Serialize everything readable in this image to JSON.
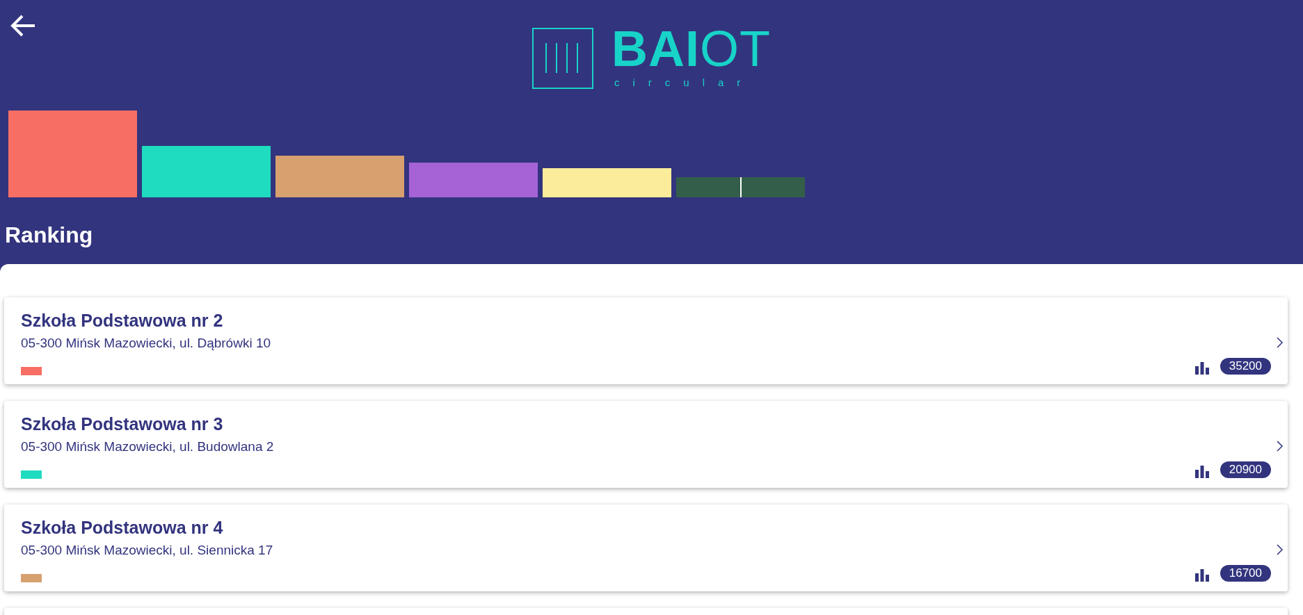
{
  "logo": {
    "wordmark": "**BAI**OT",
    "tagline": "circular"
  },
  "bars": [
    {
      "color": "#f76e64",
      "divided": false
    },
    {
      "color": "#1fdbbf",
      "divided": false
    },
    {
      "color": "#d7a06f",
      "divided": false
    },
    {
      "color": "#a563d6",
      "divided": false
    },
    {
      "color": "#faec9a",
      "divided": false
    },
    {
      "color": "#335e4a",
      "divided": true
    }
  ],
  "heading": "Ranking",
  "schools": [
    {
      "name": "Szkoła Podstawowa nr 2",
      "address": "05-300 Mińsk Mazowiecki, ul. Dąbrówki 10",
      "color": "#f76e64",
      "score": "35200"
    },
    {
      "name": "Szkoła Podstawowa nr 3",
      "address": "05-300 Mińsk Mazowiecki, ul. Budowlana 2",
      "color": "#1fdbbf",
      "score": "20900"
    },
    {
      "name": "Szkoła Podstawowa nr 4",
      "address": "05-300 Mińsk Mazowiecki, ul. Siennicka 17",
      "color": "#d7a06f",
      "score": "16700"
    }
  ]
}
